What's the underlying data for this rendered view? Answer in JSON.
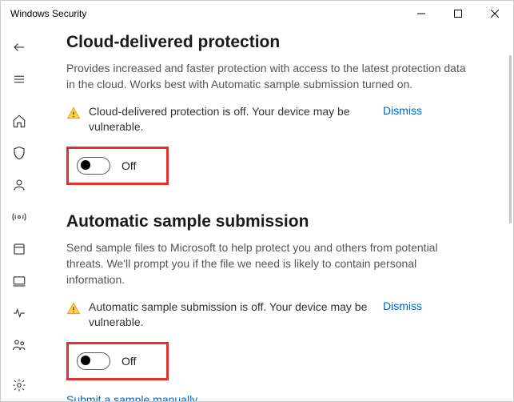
{
  "window": {
    "title": "Windows Security"
  },
  "sections": {
    "cloud": {
      "heading": "Cloud-delivered protection",
      "description": "Provides increased and faster protection with access to the latest protection data in the cloud. Works best with Automatic sample submission turned on.",
      "warning": "Cloud-delivered protection is off. Your device may be vulnerable.",
      "dismiss": "Dismiss",
      "toggle_label": "Off"
    },
    "sample": {
      "heading": "Automatic sample submission",
      "description": "Send sample files to Microsoft to help protect you and others from potential threats. We'll prompt you if the file we need is likely to contain personal information.",
      "warning": "Automatic sample submission is off. Your device may be vulnerable.",
      "dismiss": "Dismiss",
      "toggle_label": "Off",
      "link": "Submit a sample manually"
    }
  }
}
